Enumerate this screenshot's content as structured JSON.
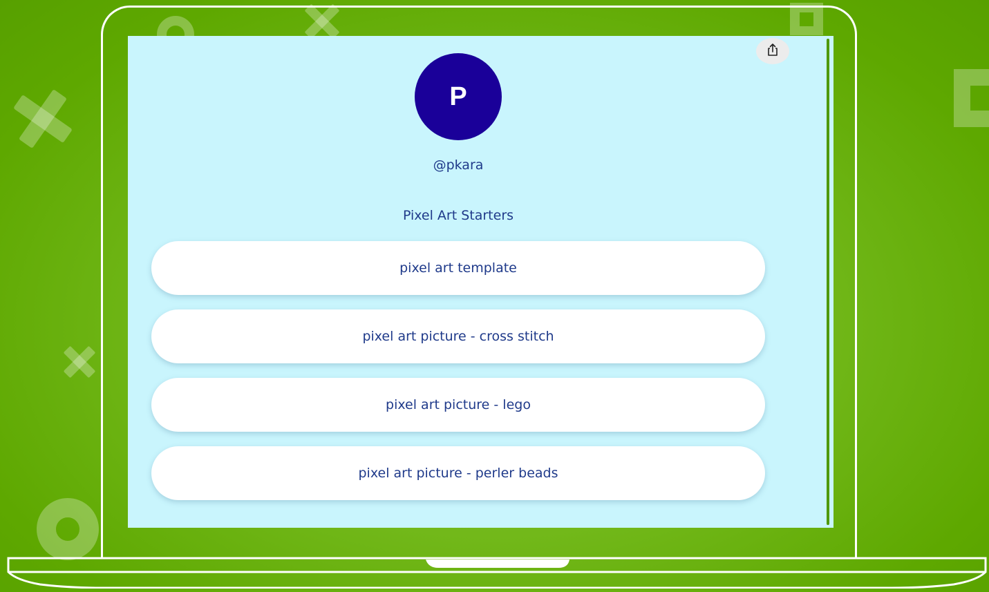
{
  "profile": {
    "avatar_initial": "P",
    "username": "@pkara",
    "title": "Pixel Art Starters"
  },
  "links": [
    {
      "label": "pixel art template"
    },
    {
      "label": "pixel art picture - cross stitch"
    },
    {
      "label": "pixel art picture - lego"
    },
    {
      "label": "pixel art picture - perler beads"
    }
  ],
  "icons": {
    "share": "share-icon"
  },
  "colors": {
    "background": "#6bb50e",
    "screen": "#c9f5fd",
    "avatar": "#1a0099",
    "text": "#1f3a8a",
    "button": "#ffffff"
  }
}
